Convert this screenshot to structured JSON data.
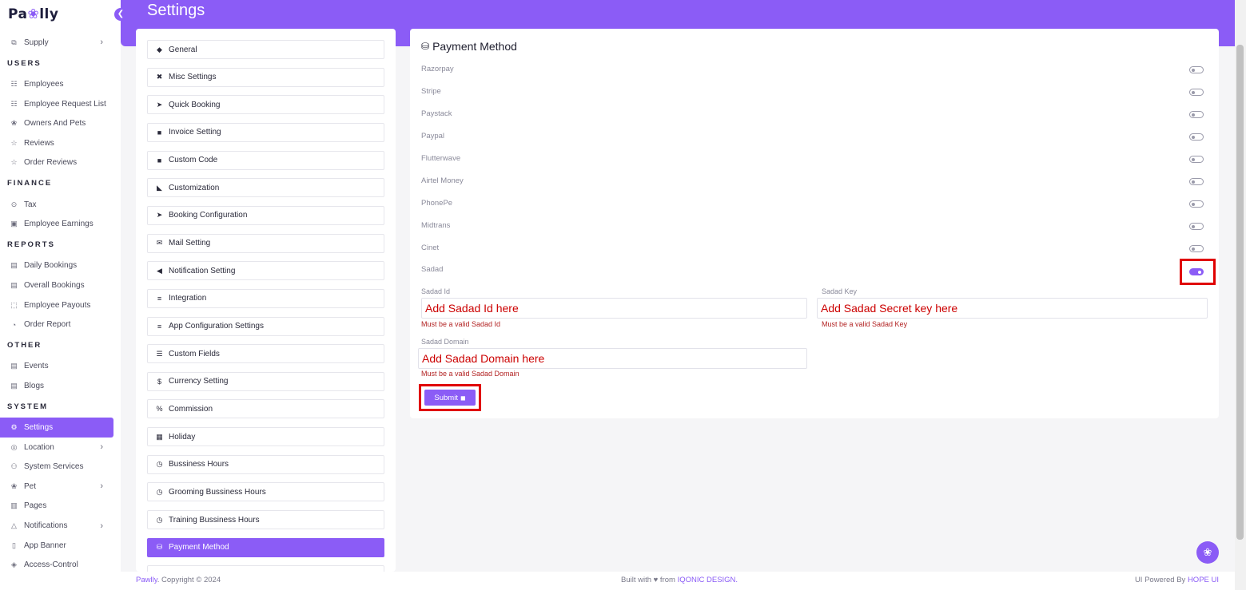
{
  "app": {
    "logo_pre": "Pa",
    "logo_paw": "❀",
    "logo_post": "lly"
  },
  "sidebar": {
    "items": [
      {
        "type": "item",
        "label": "Supply",
        "icon": "⧉",
        "chevron": true,
        "name": "sidebar-item-supply"
      },
      {
        "type": "section",
        "label": "USERS"
      },
      {
        "type": "item",
        "label": "Employees",
        "icon": "☷",
        "name": "sidebar-item-employees"
      },
      {
        "type": "item",
        "label": "Employee Request List",
        "icon": "☷",
        "name": "sidebar-item-employee-request-list"
      },
      {
        "type": "item",
        "label": "Owners And Pets",
        "icon": "❀",
        "name": "sidebar-item-owners-and-pets"
      },
      {
        "type": "item",
        "label": "Reviews",
        "icon": "☆",
        "name": "sidebar-item-reviews"
      },
      {
        "type": "item",
        "label": "Order Reviews",
        "icon": "☆",
        "name": "sidebar-item-order-reviews"
      },
      {
        "type": "section",
        "label": "FINANCE"
      },
      {
        "type": "item",
        "label": "Tax",
        "icon": "⊙",
        "name": "sidebar-item-tax"
      },
      {
        "type": "item",
        "label": "Employee Earnings",
        "icon": "▣",
        "name": "sidebar-item-employee-earnings"
      },
      {
        "type": "section",
        "label": "REPORTS"
      },
      {
        "type": "item",
        "label": "Daily Bookings",
        "icon": "▤",
        "name": "sidebar-item-daily-bookings"
      },
      {
        "type": "item",
        "label": "Overall Bookings",
        "icon": "▤",
        "name": "sidebar-item-overall-bookings"
      },
      {
        "type": "item",
        "label": "Employee Payouts",
        "icon": "⬚",
        "name": "sidebar-item-employee-payouts"
      },
      {
        "type": "item",
        "label": "Order Report",
        "icon": "◔",
        "name": "sidebar-item-order-report"
      },
      {
        "type": "section",
        "label": "OTHER"
      },
      {
        "type": "item",
        "label": "Events",
        "icon": "▤",
        "name": "sidebar-item-events"
      },
      {
        "type": "item",
        "label": "Blogs",
        "icon": "▤",
        "name": "sidebar-item-blogs"
      },
      {
        "type": "section",
        "label": "SYSTEM"
      },
      {
        "type": "item",
        "label": "Settings",
        "icon": "⚙",
        "active": true,
        "name": "sidebar-item-settings"
      },
      {
        "type": "item",
        "label": "Location",
        "icon": "◎",
        "chevron": true,
        "name": "sidebar-item-location"
      },
      {
        "type": "item",
        "label": "System Services",
        "icon": "⚇",
        "name": "sidebar-item-system-services"
      },
      {
        "type": "item",
        "label": "Pet",
        "icon": "❀",
        "chevron": true,
        "name": "sidebar-item-pet"
      },
      {
        "type": "item",
        "label": "Pages",
        "icon": "▥",
        "name": "sidebar-item-pages"
      },
      {
        "type": "item",
        "label": "Notifications",
        "icon": "△",
        "chevron": true,
        "name": "sidebar-item-notifications"
      },
      {
        "type": "item",
        "label": "App Banner",
        "icon": "▯",
        "name": "sidebar-item-app-banner"
      },
      {
        "type": "item",
        "label": "Access-Control",
        "icon": "◈",
        "name": "sidebar-item-access-control"
      }
    ]
  },
  "header": {
    "title": "Settings"
  },
  "settings_menu": {
    "items": [
      {
        "label": "General",
        "icon": "◆",
        "name": "menu-general"
      },
      {
        "label": "Misc Settings",
        "icon": "✖",
        "name": "menu-misc-settings"
      },
      {
        "label": "Quick Booking",
        "icon": "➤",
        "name": "menu-quick-booking"
      },
      {
        "label": "Invoice Setting",
        "icon": "■",
        "name": "menu-invoice-setting"
      },
      {
        "label": "Custom Code",
        "icon": "■",
        "name": "menu-custom-code"
      },
      {
        "label": "Customization",
        "icon": "◣",
        "name": "menu-customization"
      },
      {
        "label": "Booking Configuration",
        "icon": "➤",
        "name": "menu-booking-configuration"
      },
      {
        "label": "Mail Setting",
        "icon": "✉",
        "name": "menu-mail-setting"
      },
      {
        "label": "Notification Setting",
        "icon": "◀",
        "name": "menu-notification-setting"
      },
      {
        "label": "Integration",
        "icon": "≡",
        "name": "menu-integration"
      },
      {
        "label": "App Configuration Settings",
        "icon": "≡",
        "name": "menu-app-configuration-settings"
      },
      {
        "label": "Custom Fields",
        "icon": "☰",
        "name": "menu-custom-fields"
      },
      {
        "label": "Currency Setting",
        "icon": "$",
        "name": "menu-currency-setting"
      },
      {
        "label": "Commission",
        "icon": "%",
        "name": "menu-commission"
      },
      {
        "label": "Holiday",
        "icon": "▦",
        "name": "menu-holiday"
      },
      {
        "label": "Bussiness Hours",
        "icon": "◷",
        "name": "menu-bussiness-hours"
      },
      {
        "label": "Grooming Bussiness Hours",
        "icon": "◷",
        "name": "menu-grooming-bussiness-hours"
      },
      {
        "label": "Training Bussiness Hours",
        "icon": "◷",
        "name": "menu-training-bussiness-hours"
      },
      {
        "label": "Payment Method",
        "icon": "⛁",
        "active": true,
        "name": "menu-payment-method"
      },
      {
        "label": "",
        "icon": "",
        "name": "menu-next-partial"
      }
    ]
  },
  "payment": {
    "title": "Payment Method",
    "title_icon": "⛁",
    "gateways": [
      {
        "label": "Razorpay",
        "on": false
      },
      {
        "label": "Stripe",
        "on": false
      },
      {
        "label": "Paystack",
        "on": false
      },
      {
        "label": "Paypal",
        "on": false
      },
      {
        "label": "Flutterwave",
        "on": false
      },
      {
        "label": "Airtel Money",
        "on": false
      },
      {
        "label": "PhonePe",
        "on": false
      },
      {
        "label": "Midtrans",
        "on": false
      },
      {
        "label": "Cinet",
        "on": false
      },
      {
        "label": "Sadad",
        "on": true
      }
    ],
    "sadad_id": {
      "label": "Sadad Id",
      "placeholder": "Add Sadad Id here",
      "error": "Must be a valid Sadad Id"
    },
    "sadad_key": {
      "label": "Sadad Key",
      "placeholder": "Add Sadad Secret key here",
      "error": "Must be a valid Sadad Key"
    },
    "sadad_domain": {
      "label": "Sadad Domain",
      "placeholder": "Add Sadad Domain here",
      "error": "Must be a valid Sadad Domain"
    },
    "submit_label": "Submit",
    "submit_icon": "◼"
  },
  "footer": {
    "brand": "Pawlly",
    "copyright": ". Copyright © 2024",
    "built_pre": "Built with ♥ from ",
    "built_brand": "IQONIC DESIGN.",
    "powered_pre": "UI Powered By ",
    "powered_brand": "HOPE UI"
  },
  "fab_icon": "❀",
  "colors": {
    "accent": "#8b5cf6",
    "error": "#cc0000",
    "highlight": "#e00000"
  }
}
